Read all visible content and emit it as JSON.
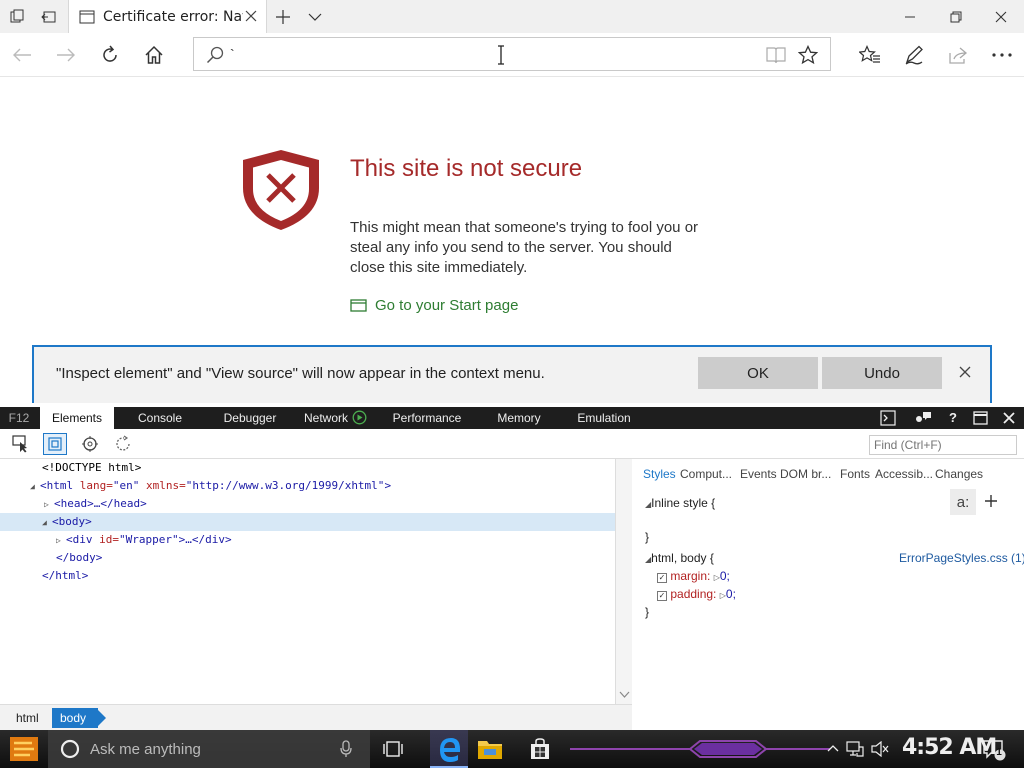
{
  "browser": {
    "tab_title": "Certificate error: Naviga",
    "address_value": "`"
  },
  "error_page": {
    "title": "This site is not secure",
    "body": "This might mean that someone's trying to fool you or steal any info you send to the server. You should close this site immediately.",
    "start_link": "Go to your Start page",
    "accent_color": "#a52a2a"
  },
  "notification": {
    "message": "\"Inspect element\" and \"View source\" will now appear in the context menu.",
    "ok_label": "OK",
    "undo_label": "Undo"
  },
  "devtools": {
    "tabs": [
      {
        "label": "F12"
      },
      {
        "label": "Elements"
      },
      {
        "label": "Console"
      },
      {
        "label": "Debugger"
      },
      {
        "label": "Network"
      },
      {
        "label": "Performance"
      },
      {
        "label": "Memory"
      },
      {
        "label": "Emulation"
      }
    ],
    "active_tab": "Elements",
    "find_placeholder": "Find (Ctrl+F)",
    "dom": {
      "doctype": "<!DOCTYPE html>",
      "html_open_tag": "<html",
      "html_lang_attr": "lang=",
      "html_lang_val": "\"en\"",
      "html_xmlns_attr": "xmlns=",
      "html_xmlns_val": "\"http://www.w3.org/1999/xhtml\"",
      "html_close_bracket": ">",
      "head": "<head>…</head>",
      "body_open": "<body>",
      "div_open": "<div",
      "div_id_attr": "id=",
      "div_id_val": "\"Wrapper\"",
      "div_rest": ">…</div>",
      "body_close": "</body>",
      "html_close": "</html>"
    },
    "breadcrumb": [
      "html",
      "body"
    ],
    "styles_tabs": [
      "Styles",
      "Comput...",
      "Events",
      "DOM br...",
      "Fonts",
      "Accessib...",
      "Changes"
    ],
    "styles": {
      "inline_label": "Inline style  {",
      "inline_close": "}",
      "rule_selector": "html, body  {",
      "rule_source": "ErrorPageStyles.css (1)",
      "margin_prop": "margin:",
      "margin_val": "0;",
      "padding_prop": "padding:",
      "padding_val": "0;",
      "rule_close": "}",
      "a_colon": "a:"
    }
  },
  "taskbar": {
    "search_placeholder": "Ask me anything",
    "clock": "4:52 AM",
    "notification_count": "1"
  }
}
